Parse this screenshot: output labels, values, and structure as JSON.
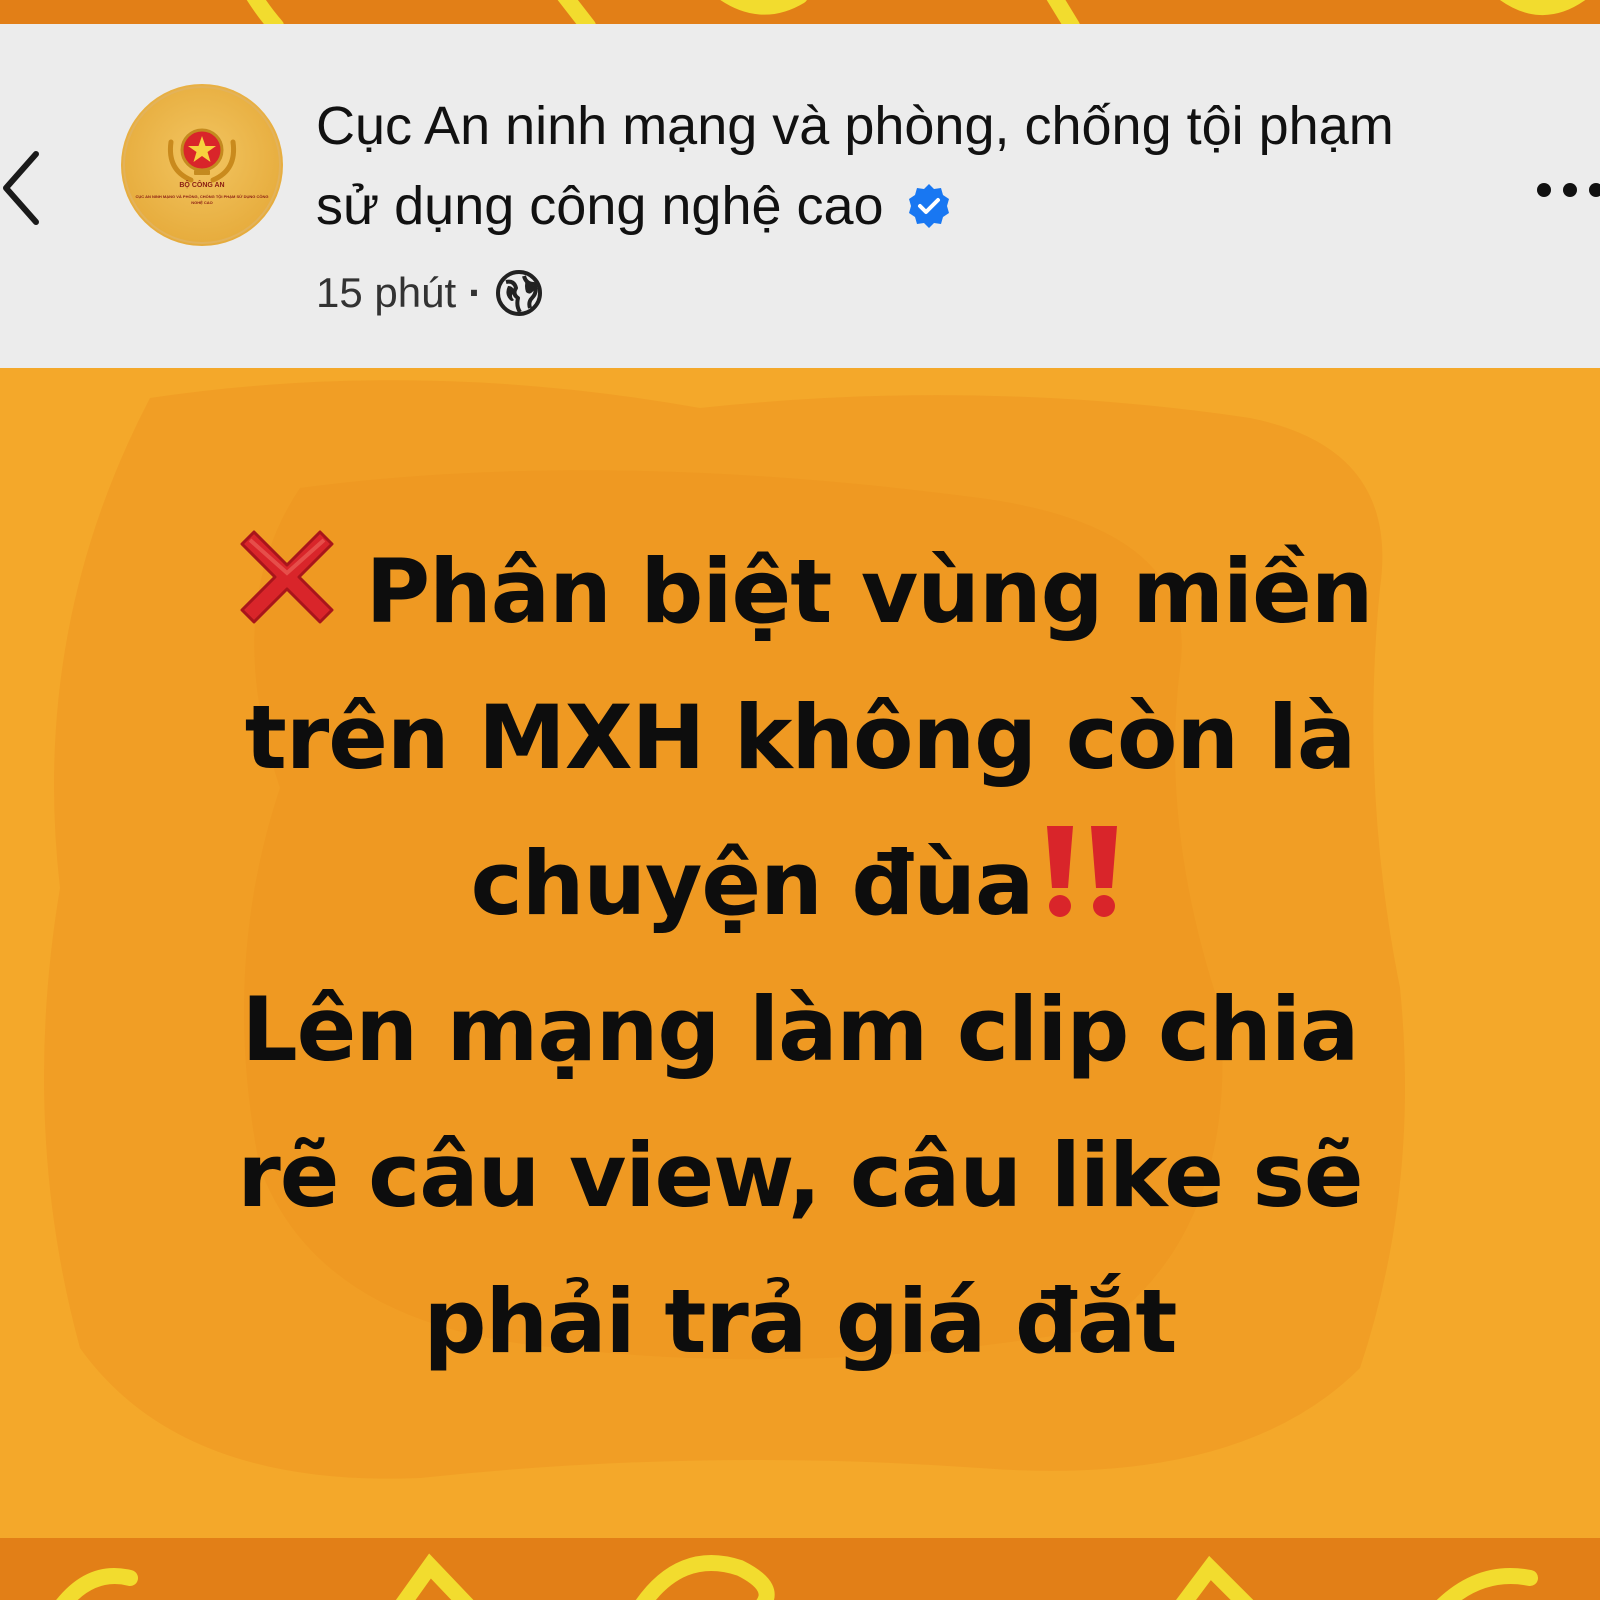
{
  "header": {
    "page_name": "Cục An ninh mạng và phòng, chống tội phạm sử dụng công nghệ cao",
    "time": "15 phút",
    "separator": "·",
    "privacy_icon": "globe-icon",
    "verified_icon": "verified-badge-icon",
    "back_icon": "chevron-left-icon",
    "more_icon": "more-horizontal-icon"
  },
  "avatar": {
    "org_line": "BỘ CÔNG AN",
    "sub_line": "CỤC AN NINH MẠNG VÀ PHÒNG, CHỐNG TỘI PHẠM SỬ DỤNG CÔNG NGHỆ CAO"
  },
  "post": {
    "lines": [
      "Phân biệt vùng miền",
      "trên MXH không còn là",
      "chuyện đùa",
      "Lên mạng làm clip chia",
      "rẽ câu view, câu like sẽ",
      "phải trả giá đắt"
    ],
    "lead_emoji": "cross-mark-icon",
    "trail_emoji": "double-exclamation-icon"
  },
  "colors": {
    "header_bg": "#ececec",
    "post_bg": "#f3a526",
    "frame_bg": "#e27f17",
    "frame_pattern": "#f2dc2e",
    "verified_blue": "#1877f2",
    "emoji_red": "#d9252a",
    "text": "#0d0d0d"
  }
}
